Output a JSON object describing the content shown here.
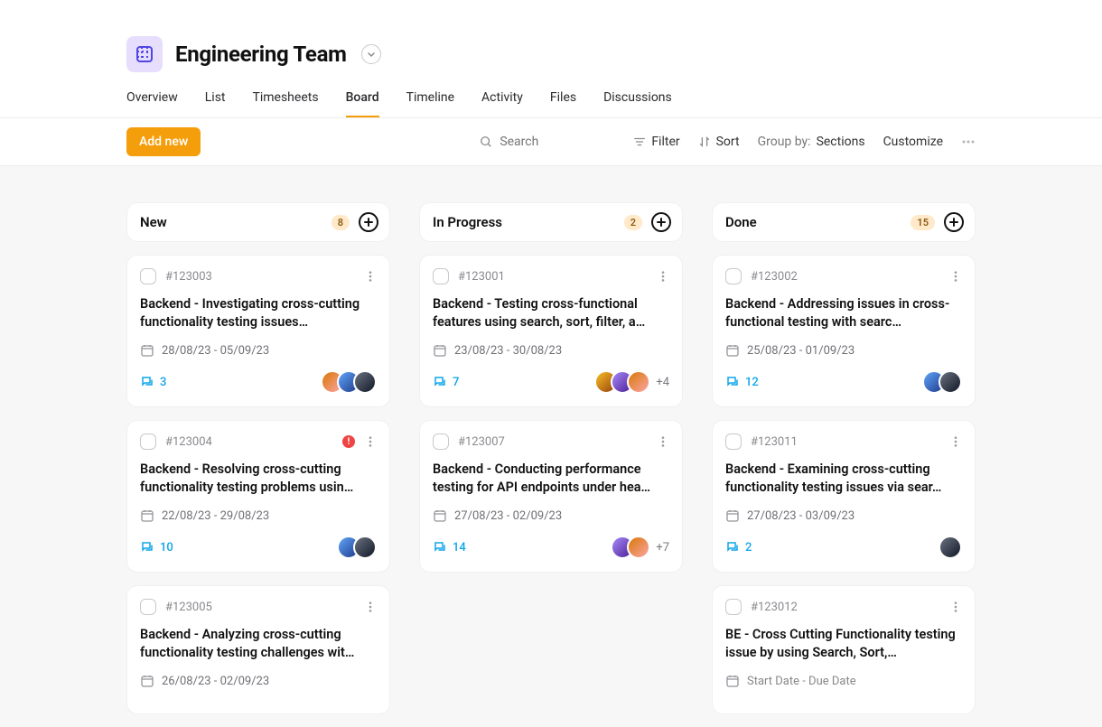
{
  "header": {
    "title": "Engineering Team"
  },
  "tabs": [
    {
      "label": "Overview",
      "active": false
    },
    {
      "label": "List",
      "active": false
    },
    {
      "label": "Timesheets",
      "active": false
    },
    {
      "label": "Board",
      "active": true
    },
    {
      "label": "Timeline",
      "active": false
    },
    {
      "label": "Activity",
      "active": false
    },
    {
      "label": "Files",
      "active": false
    },
    {
      "label": "Discussions",
      "active": false
    }
  ],
  "toolbar": {
    "add_label": "Add new",
    "search_placeholder": "Search",
    "filter_label": "Filter",
    "sort_label": "Sort",
    "groupby_prefix": "Group by:",
    "groupby_value": "Sections",
    "customize_label": "Customize"
  },
  "columns": [
    {
      "title": "New",
      "count": "8",
      "cards": [
        {
          "id": "#123003",
          "title": "Backend - Investigating cross-cutting functionality testing issues…",
          "dates": "28/08/23 - 05/09/23",
          "comments": "3",
          "alert": false,
          "avatars": 3,
          "overflow": ""
        },
        {
          "id": "#123004",
          "title": "Backend - Resolving cross-cutting functionality testing problems usin…",
          "dates": "22/08/23 - 29/08/23",
          "comments": "10",
          "alert": true,
          "avatars": 2,
          "overflow": ""
        },
        {
          "id": "#123005",
          "title": "Backend - Analyzing cross-cutting functionality testing challenges wit…",
          "dates": "26/08/23 - 02/09/23",
          "comments": "",
          "alert": false,
          "avatars": 0,
          "overflow": ""
        }
      ]
    },
    {
      "title": "In Progress",
      "count": "2",
      "cards": [
        {
          "id": "#123001",
          "title": "Backend - Testing cross-functional features using search, sort, filter, a…",
          "dates": "23/08/23 - 30/08/23",
          "comments": "7",
          "alert": false,
          "avatars": 3,
          "overflow": "+4"
        },
        {
          "id": "#123007",
          "title": "Backend - Conducting performance testing for API endpoints under hea…",
          "dates": "27/08/23 - 02/09/23",
          "comments": "14",
          "alert": false,
          "avatars": 2,
          "overflow": "+7"
        }
      ]
    },
    {
      "title": "Done",
      "count": "15",
      "cards": [
        {
          "id": "#123002",
          "title": "Backend - Addressing issues in cross-functional testing with searc…",
          "dates": "25/08/23 - 01/09/23",
          "comments": "12",
          "alert": false,
          "avatars": 2,
          "overflow": ""
        },
        {
          "id": "#123011",
          "title": "Backend - Examining cross-cutting functionality testing issues via sear…",
          "dates": "27/08/23 - 03/09/23",
          "comments": "2",
          "alert": false,
          "avatars": 1,
          "overflow": ""
        },
        {
          "id": "#123012",
          "title": "BE - Cross Cutting Functionality testing issue by using Search, Sort,…",
          "dates": "Start Date - Due Date",
          "comments": "",
          "alert": false,
          "avatars": 0,
          "overflow": "",
          "date_placeholder": true
        }
      ]
    }
  ]
}
